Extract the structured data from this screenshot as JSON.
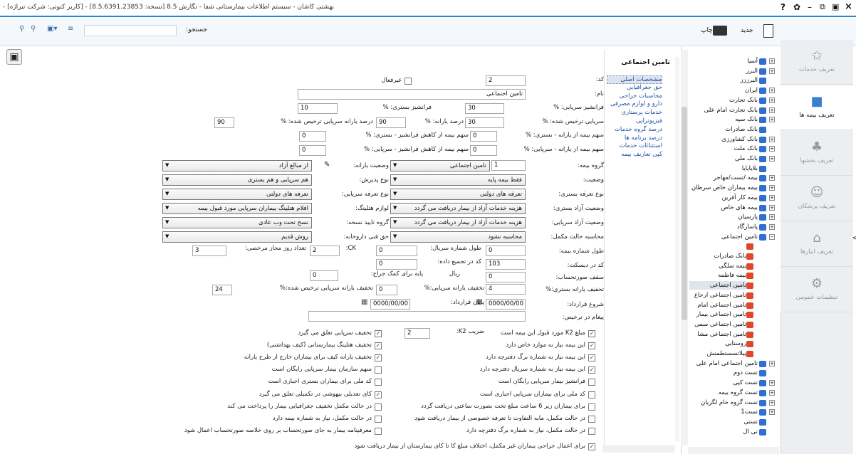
{
  "window": {
    "title": "- [کاربر کنونی: شرکت تیراژه] - بهشتی کاشان - سیستم اطلاعات بیمارستانی شفا - نگارش 8.5 [نسخه: 8.5.6391.23853]",
    "close": "×",
    "help": "?",
    "gear": "✿",
    "minimize": "–",
    "restore": "⧉",
    "maximize": "▣"
  },
  "toolbar": {
    "new_label": "جدید",
    "print_label": "چاپ",
    "search_label": "جستجو:",
    "search_value": ""
  },
  "sidebar": [
    {
      "label": "تعریف خدمات",
      "icon": "✩"
    },
    {
      "label": "تعریف بیمه ها",
      "icon": "■"
    },
    {
      "label": "تعریف بخشها",
      "icon": "♣"
    },
    {
      "label": "تعریف پزشکان",
      "icon": "☺"
    },
    {
      "label": "تعریف انبارها",
      "icon": "⌂"
    },
    {
      "label": "تنظیمات عمومی",
      "icon": "⚙"
    }
  ],
  "tree": [
    {
      "label": "آسیا",
      "type": "b",
      "exp": "+"
    },
    {
      "label": "البرز",
      "type": "b",
      "exp": "+"
    },
    {
      "label": "البرززز",
      "type": "b",
      "exp": ""
    },
    {
      "label": "ایران",
      "type": "b",
      "exp": "+"
    },
    {
      "label": "بانک تجارت",
      "type": "b",
      "exp": "+"
    },
    {
      "label": "بانک تجارت امام علی",
      "type": "b",
      "exp": "+"
    },
    {
      "label": "بانک سپه",
      "type": "b",
      "exp": "+"
    },
    {
      "label": "بانک صادرات",
      "type": "b",
      "exp": ""
    },
    {
      "label": "بانک کشاورزی",
      "type": "b",
      "exp": "+"
    },
    {
      "label": "بانک ملت",
      "type": "b",
      "exp": "+"
    },
    {
      "label": "بانک ملی",
      "type": "b",
      "exp": "+"
    },
    {
      "label": "بلایایایا",
      "type": "b",
      "exp": ""
    },
    {
      "label": "بیمه /تست/مهاجر",
      "type": "b",
      "exp": "+"
    },
    {
      "label": "بیمه بیماران خاص سرطان",
      "type": "b",
      "exp": "+"
    },
    {
      "label": "بیمه کار آفرین",
      "type": "b",
      "exp": "+"
    },
    {
      "label": "بیمه های خاص",
      "type": "b",
      "exp": "+"
    },
    {
      "label": "پارسیان",
      "type": "b",
      "exp": "+"
    },
    {
      "label": "پاسارگاد",
      "type": "b",
      "exp": "+"
    },
    {
      "label": "تامین اجتماعی",
      "type": "b",
      "exp": "−"
    },
    {
      "label": "",
      "type": "r",
      "exp": ""
    },
    {
      "label": "بانک صادرات",
      "type": "r",
      "exp": ""
    },
    {
      "label": "بیمه سلگی",
      "type": "r",
      "exp": ""
    },
    {
      "label": "بیمه فاطمه",
      "type": "r",
      "exp": ""
    },
    {
      "label": "تامین اجتماعی",
      "type": "r",
      "exp": "",
      "sel": true
    },
    {
      "label": "تامین اجتماعی ارجاع",
      "type": "r",
      "exp": ""
    },
    {
      "label": "تامین اجتماعی امام",
      "type": "r",
      "exp": ""
    },
    {
      "label": "تامین اجتماعی بیمار",
      "type": "r",
      "exp": ""
    },
    {
      "label": "تامین اجتماعی سمی",
      "type": "r",
      "exp": ""
    },
    {
      "label": "تامین اجتماعی مشا",
      "type": "r",
      "exp": ""
    },
    {
      "label": "روستایی",
      "type": "r",
      "exp": ""
    },
    {
      "label": "پیلاتسستطمنش",
      "type": "r",
      "exp": ""
    },
    {
      "label": "تامین اجتماعی امام علی",
      "type": "b",
      "exp": "+"
    },
    {
      "label": "تست دوم",
      "type": "b",
      "exp": ""
    },
    {
      "label": "تست کپی",
      "type": "b",
      "exp": "+"
    },
    {
      "label": "تست گروه بیمه",
      "type": "b",
      "exp": "+"
    },
    {
      "label": "تست گروه خام لگزیان",
      "type": "b",
      "exp": "+"
    },
    {
      "label": "تست1",
      "type": "b",
      "exp": "+"
    },
    {
      "label": "تستی",
      "type": "b",
      "exp": ""
    },
    {
      "label": "تی ال",
      "type": "b",
      "exp": ""
    }
  ],
  "form": {
    "heading": "تامین اجتماعی",
    "nav": [
      "مشخصات اصلی",
      "حق جغرافیایی",
      "محاسبات جراحی",
      "دارو و لوازم مصرفی",
      "خدمات پرستاری",
      "فیزیوتراپی",
      "درصد گروه خدمات",
      "درصد برنامه ها",
      "استثنائات خدمات",
      "کپی تعاریف بیمه"
    ],
    "labels": {
      "code": "کد:",
      "inactive": "غیرفعال",
      "name": "نام:",
      "fr_outpat": "فرانشیز سرپایی: %",
      "fr_inpat": "فرانشیز بستری: %",
      "disc_outpat": "سرپایی ترخیص شده: %",
      "subsidy_pct": "درصد یارانه: %",
      "subsidy_outpat_disc": "درصد یارانه سرپایی ترخیص شده: %",
      "ins_share_sub_inpat": "سهم بیمه از یارانه - بستری: %",
      "ins_share_fr_inpat": "سهم بیمه از کاهش فرانشیز - بستری: %",
      "ins_share_sub_outpat": "سهم بیمه از یارانه - سرپایی: %",
      "ins_share_fr_outpat": "سهم بیمه از کاهش فرانشیز - سرپایی: %",
      "ins_group": "گروه بیمه:",
      "sub_status": "وضعیت یارانه:",
      "status": "وضعیت:",
      "accept_type": "نوع پذیرش:",
      "tariff_inpat": "نوع تعرفه بستری:",
      "tariff_outpat": "نوع تعرفه سرپایی:",
      "free_inpat": "وضعیت آزاد بستری:",
      "consumables": "لوازم هتلینگ:",
      "free_outpat": "وضعیت آزاد سرپایی:",
      "rx_confirm": "گروه تایید نسخه:",
      "supp_calc": "محاسبه حالت مکمل:",
      "pharm_fee": "حق فنی داروخانه:",
      "ins_no_len": "طول شماره بیمه:",
      "serial_len": "طول شماره سریال:",
      "ck": "CK:",
      "leave_days": "تعداد روز مجاز مرخصی:",
      "diskette": "کد در دیسکت:",
      "aggregate": "کد در تجمیع داده:",
      "ceiling": "سقف صورتحساب:",
      "rial": "ریال",
      "surg_base": "پایه برای کمک جراح:",
      "disc_inpat": "تخفیف یارانه بستری:%",
      "disc_outpat2": "تخفیف یارانه سرپایی:%",
      "disc_outpat_rel": "تخفیف یارانه سرپایی ترخیص شده:%",
      "start": "شروع قرارداد:",
      "end": "پایان قرارداد:",
      "msg": "پیغام در ترخیص:",
      "k2": "ضریب K2:"
    },
    "values": {
      "code": "2",
      "name": "تامین اجتماعی",
      "fr_outpat": "30",
      "fr_inpat": "10",
      "disc_outpat": "30",
      "subsidy_pct": "90",
      "subsidy_outpat_disc": "90",
      "ins_share_sub_inpat": "0",
      "ins_share_fr_inpat": "0",
      "ins_share_sub_outpat": "0",
      "ins_share_fr_outpat": "0",
      "ins_group": "تامین اجتماعی",
      "ins_group_no": "1",
      "sub_status": "از مبالغ آزاد",
      "status": "فقط بیمه پایه",
      "accept_type": "هم سرپایی و هم بستری",
      "tariff_inpat": "تعرفه های دولتی",
      "tariff_outpat": "تعرفه های دولتی",
      "free_inpat": "هزینه خدمات آزاد از بیمار دریافت می گردد",
      "consumables": "اقلام هتلینگ بیماران سرپایی مورد قبول بیمه",
      "free_outpat": "هزینه خدمات آزاد از بیمار دریافت می گردد",
      "rx_confirm": "نسخ تحت وب عادی",
      "supp_calc": "محاسبه نشود",
      "pharm_fee": "روش قدیم",
      "ins_no_len": "0",
      "serial_len": "0",
      "ck": "2",
      "leave_days": "3",
      "diskette": "103",
      "aggregate": "0",
      "ceiling": "0",
      "surg_base": "0",
      "disc_inpat": "4",
      "disc_outpat2": "0",
      "disc_outpat_rel": "24",
      "start": "0000/00/00",
      "end": "0000/00/00",
      "msg": "",
      "k2": "2"
    },
    "checks_right": [
      {
        "label": "مبلغ K2 مورد قبول این بیمه است",
        "on": true
      },
      {
        "label": "این بیمه نیاز به موارد خاص دارد",
        "on": true
      },
      {
        "label": "این بیمه نیاز به شماره برگ دفترچه دارد",
        "on": true
      },
      {
        "label": "این بیمه نیاز به شماره سریال دفترچه دارد",
        "on": true
      },
      {
        "label": "فرانشیز بیمار سرپایی رایگان است",
        "on": false
      },
      {
        "label": "کد ملی برای بیماران سرپایی اجباری است",
        "on": false
      },
      {
        "label": "برای بیماران زیر 6 ساعت مبلغ تخت بصورت ساعتی دریافت گردد",
        "on": false
      },
      {
        "label": "در حالت مکمل، مابه التفاوت تا تعرفه خصوصی از بیمار دریافت شود",
        "on": false
      },
      {
        "label": "در حالت مکمل، نیاز به شماره برگ دفترچه دارد",
        "on": false
      },
      {
        "label": "برای اعمال جراحی بیماران غیر مکمل، اختلاف مبلغ کا تا کای بیمارستان از بیمار دریافت شود",
        "on": true
      }
    ],
    "checks_left": [
      {
        "label": "تخفیف سرپایی تعلق می گیرد",
        "on": true
      },
      {
        "label": "تخفیف هتلینگ بیمارستانی (کیف بهداشتی)",
        "on": true
      },
      {
        "label": "تخفیف یارانه کیف برای بیماران خارج از طرح یارانه",
        "on": true
      },
      {
        "label": "سهم سازمان بیمار سرپایی رایگان است",
        "on": false
      },
      {
        "label": "کد ملی برای بیماران بستری اجباری است",
        "on": false
      },
      {
        "label": "کای تعدیلی بیهوشی در تکمیلی تعلق می گیرد",
        "on": true
      },
      {
        "label": "در حالت مکمل تخفیف جغرافیایی بیمار را پرداخت می کند",
        "on": false
      },
      {
        "label": "در حالت مکمل، نیاز به شماره بیمه دارد",
        "on": false
      },
      {
        "label": "معرفینامه بیمار به جای صورتحساب بر روی خلاصه صورتحساب اعمال شود",
        "on": false
      }
    ]
  }
}
